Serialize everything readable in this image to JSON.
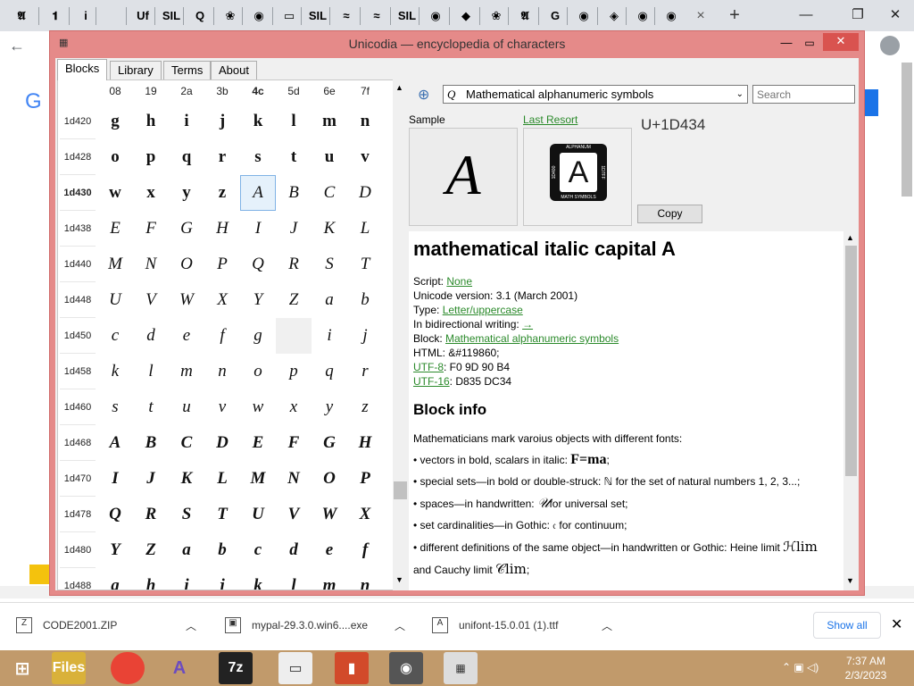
{
  "browser": {
    "tab_icons": [
      "𝕬",
      "𝟏",
      "i",
      "",
      "Uf",
      "SIL",
      "Q",
      "❀",
      "◉",
      "▭",
      "SIL",
      "≈",
      "≈",
      "SIL",
      "◉",
      "◆",
      "❀",
      "𝕬",
      "G",
      "◉",
      "◈",
      "◉",
      "◉"
    ],
    "close_tab": "×",
    "new_tab": "+"
  },
  "app": {
    "title": "Unicodia — encyclopedia of characters",
    "tabs": [
      "Blocks",
      "Library",
      "Terms",
      "About"
    ],
    "columns": [
      "08",
      "19",
      "2a",
      "3b",
      "4c",
      "5d",
      "6e",
      "7f"
    ],
    "rows": [
      {
        "label": "1d420",
        "cells": [
          "g",
          "h",
          "i",
          "j",
          "k",
          "l",
          "m",
          "n"
        ],
        "style": "bold"
      },
      {
        "label": "1d428",
        "cells": [
          "o",
          "p",
          "q",
          "r",
          "s",
          "t",
          "u",
          "v"
        ],
        "style": "bold"
      },
      {
        "label": "1d430",
        "cells": [
          "w",
          "x",
          "y",
          "z",
          "A",
          "B",
          "C",
          "D"
        ],
        "style": "mix"
      },
      {
        "label": "1d438",
        "cells": [
          "E",
          "F",
          "G",
          "H",
          "I",
          "J",
          "K",
          "L"
        ],
        "style": "ital"
      },
      {
        "label": "1d440",
        "cells": [
          "M",
          "N",
          "O",
          "P",
          "Q",
          "R",
          "S",
          "T"
        ],
        "style": "ital"
      },
      {
        "label": "1d448",
        "cells": [
          "U",
          "V",
          "W",
          "X",
          "Y",
          "Z",
          "a",
          "b"
        ],
        "style": "ital"
      },
      {
        "label": "1d450",
        "cells": [
          "c",
          "d",
          "e",
          "f",
          "g",
          "",
          "i",
          "j"
        ],
        "style": "ital"
      },
      {
        "label": "1d458",
        "cells": [
          "k",
          "l",
          "m",
          "n",
          "o",
          "p",
          "q",
          "r"
        ],
        "style": "ital"
      },
      {
        "label": "1d460",
        "cells": [
          "s",
          "t",
          "u",
          "v",
          "w",
          "x",
          "y",
          "z"
        ],
        "style": "ital"
      },
      {
        "label": "1d468",
        "cells": [
          "A",
          "B",
          "C",
          "D",
          "E",
          "F",
          "G",
          "H"
        ],
        "style": "bi"
      },
      {
        "label": "1d470",
        "cells": [
          "I",
          "J",
          "K",
          "L",
          "M",
          "N",
          "O",
          "P"
        ],
        "style": "bi"
      },
      {
        "label": "1d478",
        "cells": [
          "Q",
          "R",
          "S",
          "T",
          "U",
          "V",
          "W",
          "X"
        ],
        "style": "bi"
      },
      {
        "label": "1d480",
        "cells": [
          "Y",
          "Z",
          "a",
          "b",
          "c",
          "d",
          "e",
          "f"
        ],
        "style": "bi"
      },
      {
        "label": "1d488",
        "cells": [
          "g",
          "h",
          "i",
          "j",
          "k",
          "l",
          "m",
          "n"
        ],
        "style": "bi"
      }
    ],
    "block_select": "Mathematical alphanumeric symbols",
    "search_placeholder": "Search",
    "sample_label": "Sample",
    "last_resort_label": "Last Resort",
    "codepoint": "U+1D434",
    "sample_char": "A",
    "copy_label": "Copy",
    "logo_text_top": "ALPHANUM",
    "logo_text_bottom": "MATH SYMBOLS",
    "logo_text_left": "1D400",
    "logo_text_right": "1D7FF",
    "char_name": "mathematical italic capital A",
    "script_label": "Script: ",
    "script_value": "None",
    "version_line": "Unicode version: 3.1 (March 2001)",
    "type_label": "Type: ",
    "type_value": "Letter/uppercase",
    "bidi_label": "In bidirectional writing: ",
    "bidi_value": "→",
    "block_label": "Block: ",
    "block_value": "Mathematical alphanumeric symbols",
    "html_line": "HTML: &#119860;",
    "utf8_label": "UTF-8",
    "utf8_value": ": F0 9D 90 B4",
    "utf16_label": "UTF-16",
    "utf16_value": ": D835 DC34",
    "block_info_title": "Block info",
    "bi_intro": "Mathematicians mark varoius objects with different fonts:",
    "bi1": "• vectors in bold, scalars in italic: ",
    "bi1_math": "F=ma",
    "bi2": "• special sets—in bold or double-struck: ℕ for the set of natural numbers 1, 2, 3...;",
    "bi3": "• spaces—in handwritten: ",
    "bi3_math": "𝒰",
    "bi3_end": "for universal set;",
    "bi4": "• set cardinalities—in Gothic: 𝔠 for continuum;",
    "bi5": "• different definitions of the same object—in handwritten or Gothic: Heine limit ",
    "bi5_math": "ℋlim",
    "bi6": "and Cauchy limit ",
    "bi6_math": "𝒞lim",
    "bi6_end": ";"
  },
  "downloads": [
    {
      "name": "CODE2001.ZIP"
    },
    {
      "name": "mypal-29.3.0.win6....exe"
    },
    {
      "name": "unifont-15.0.01 (1).ttf"
    }
  ],
  "show_all": "Show all",
  "taskbar": {
    "time": "7:37 AM",
    "date": "2/3/2023",
    "apps": [
      "Files",
      "Chrome",
      "Unicodia",
      "7z",
      "Notepad",
      "Flashcards",
      "Raccoon",
      "Unicodia2"
    ]
  },
  "colors": {
    "app_frame": "#e58a89",
    "link": "#2b8a2b",
    "taskbar": "#c19a6b"
  }
}
